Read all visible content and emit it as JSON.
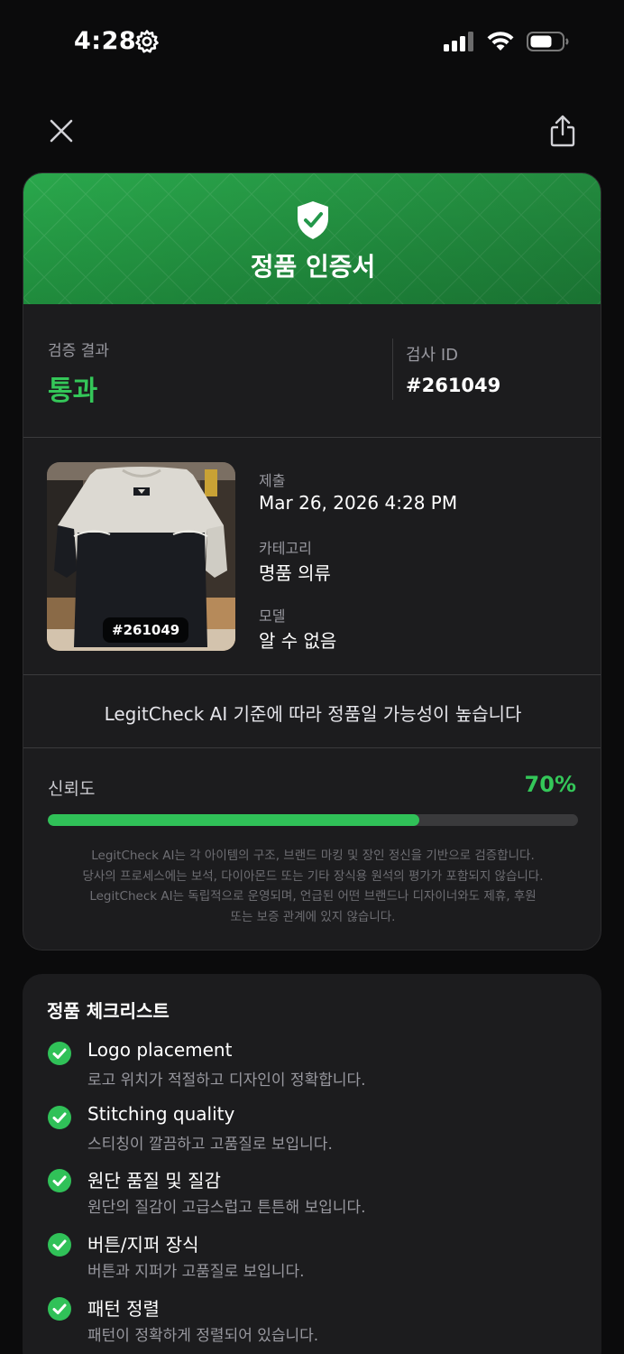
{
  "status_bar": {
    "time": "4:28"
  },
  "certificate": {
    "title": "정품 인증서",
    "result_label": "검증 결과",
    "result_value": "통과",
    "id_label": "검사 ID",
    "id_value": "#261049",
    "image_badge": "#261049",
    "submitted_label": "제출",
    "submitted_value": "Mar 26, 2026 4:28 PM",
    "category_label": "카테고리",
    "category_value": "명품 의류",
    "model_label": "모델",
    "model_value": "알 수 없음",
    "statement": "LegitCheck AI 기준에 따라 정품일 가능성이 높습니다",
    "confidence_label": "신뢰도",
    "confidence_value": "70%",
    "confidence_fraction": 0.7,
    "disclaimer_lines": [
      "LegitCheck AI는 각 아이템의 구조, 브랜드 마킹 및 장인 정신을 기반으로 검증합니다.",
      "당사의 프로세스에는 보석, 다이아몬드 또는 기타 장식용 원석의 평가가 포함되지 않습니다.",
      "LegitCheck AI는 독립적으로 운영되며, 언급된 어떤 브랜드나 디자이너와도 제휴, 후원",
      "또는 보증 관계에 있지 않습니다."
    ]
  },
  "checklist": {
    "title": "정품 체크리스트",
    "items": [
      {
        "name": "Logo placement",
        "desc": "로고 위치가 적절하고 디자인이 정확합니다."
      },
      {
        "name": "Stitching quality",
        "desc": "스티칭이 깔끔하고 고품질로 보입니다."
      },
      {
        "name": "원단 품질 및 질감",
        "desc": "원단의 질감이 고급스럽고 튼튼해 보입니다."
      },
      {
        "name": "버튼/지퍼 장식",
        "desc": "버튼과 지퍼가 고품질로 보입니다."
      },
      {
        "name": "패턴 정렬",
        "desc": "패턴이 정확하게 정렬되어 있습니다."
      }
    ]
  },
  "colors": {
    "accent_green": "#34c759",
    "header_green": "#2aa84c",
    "card_bg": "#1c1c1e",
    "page_bg": "#0b0b0c"
  },
  "icons": {
    "close": "close-icon",
    "share": "share-icon",
    "shield": "shield-check-icon",
    "check": "check-circle-icon"
  }
}
